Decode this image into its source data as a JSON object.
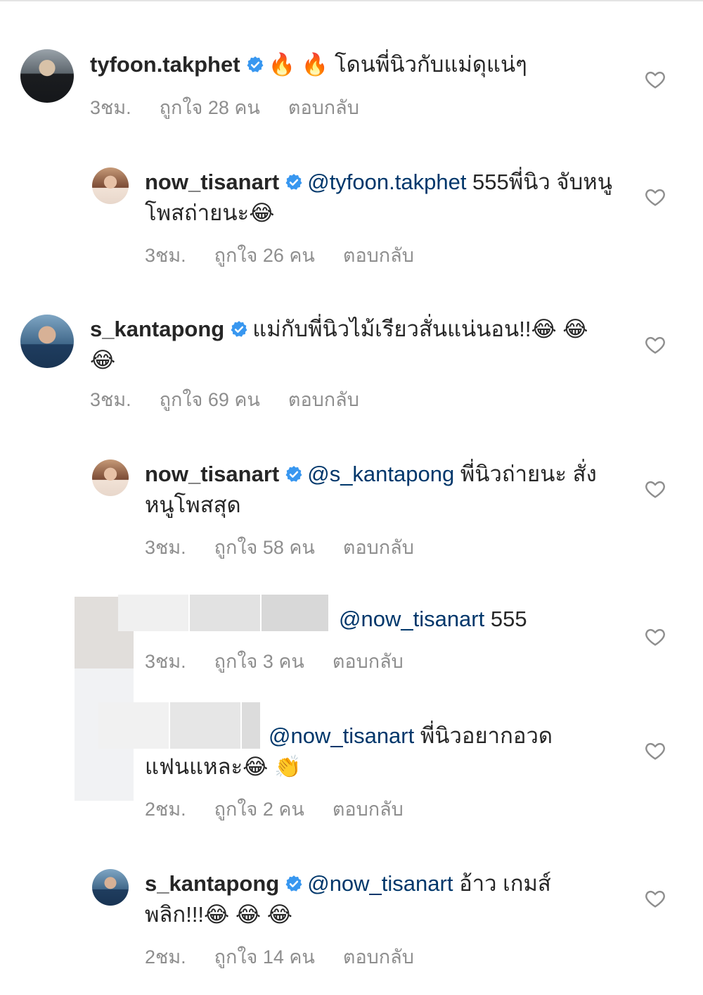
{
  "comments": [
    {
      "username": "tyfoon.takphet",
      "mention": "",
      "text": "🔥 🔥  โดนพี่นิวกับแม่ดุแน่ๆ",
      "time": "3ชม.",
      "likes": "ถูกใจ 28 คน",
      "reply": "ตอบกลับ"
    },
    {
      "username": "now_tisanart",
      "mention": "@tyfoon.takphet",
      "text": " 555พี่นิว จับหนูโพสถ่ายนะ😂",
      "time": "3ชม.",
      "likes": "ถูกใจ 26 คน",
      "reply": "ตอบกลับ"
    },
    {
      "username": "s_kantapong",
      "mention": "",
      "text": "แม่กับพี่นิวไม้เรียวสั่นแน่นอน!!😂 😂 😂",
      "time": "3ชม.",
      "likes": "ถูกใจ 69 คน",
      "reply": "ตอบกลับ"
    },
    {
      "username": "now_tisanart",
      "mention": "@s_kantapong",
      "text": " พี่นิวถ่ายนะ สั่งหนูโพสสุด",
      "time": "3ชม.",
      "likes": "ถูกใจ 58 คน",
      "reply": "ตอบกลับ"
    },
    {
      "username": "",
      "mention": "@now_tisanart",
      "text": " 555",
      "time": "3ชม.",
      "likes": "ถูกใจ 3 คน",
      "reply": "ตอบกลับ"
    },
    {
      "username": "",
      "mention": "@now_tisanart",
      "text": " พี่นิวอยากอวด แฟนแหละ😂 👏",
      "time": "2ชม.",
      "likes": "ถูกใจ 2 คน",
      "reply": "ตอบกลับ"
    },
    {
      "username": "s_kantapong",
      "mention": "@now_tisanart",
      "text": " อ้าว เกมส์ พลิก!!!😂 😂 😂",
      "time": "2ชม.",
      "likes": "ถูกใจ 14 คน",
      "reply": "ตอบกลับ"
    }
  ],
  "colors": {
    "mention": "#00376b",
    "meta": "#8e8e8e",
    "verified": "#3897f0"
  },
  "icons": {
    "verified": "verified-badge-icon",
    "like": "heart-outline-icon"
  }
}
